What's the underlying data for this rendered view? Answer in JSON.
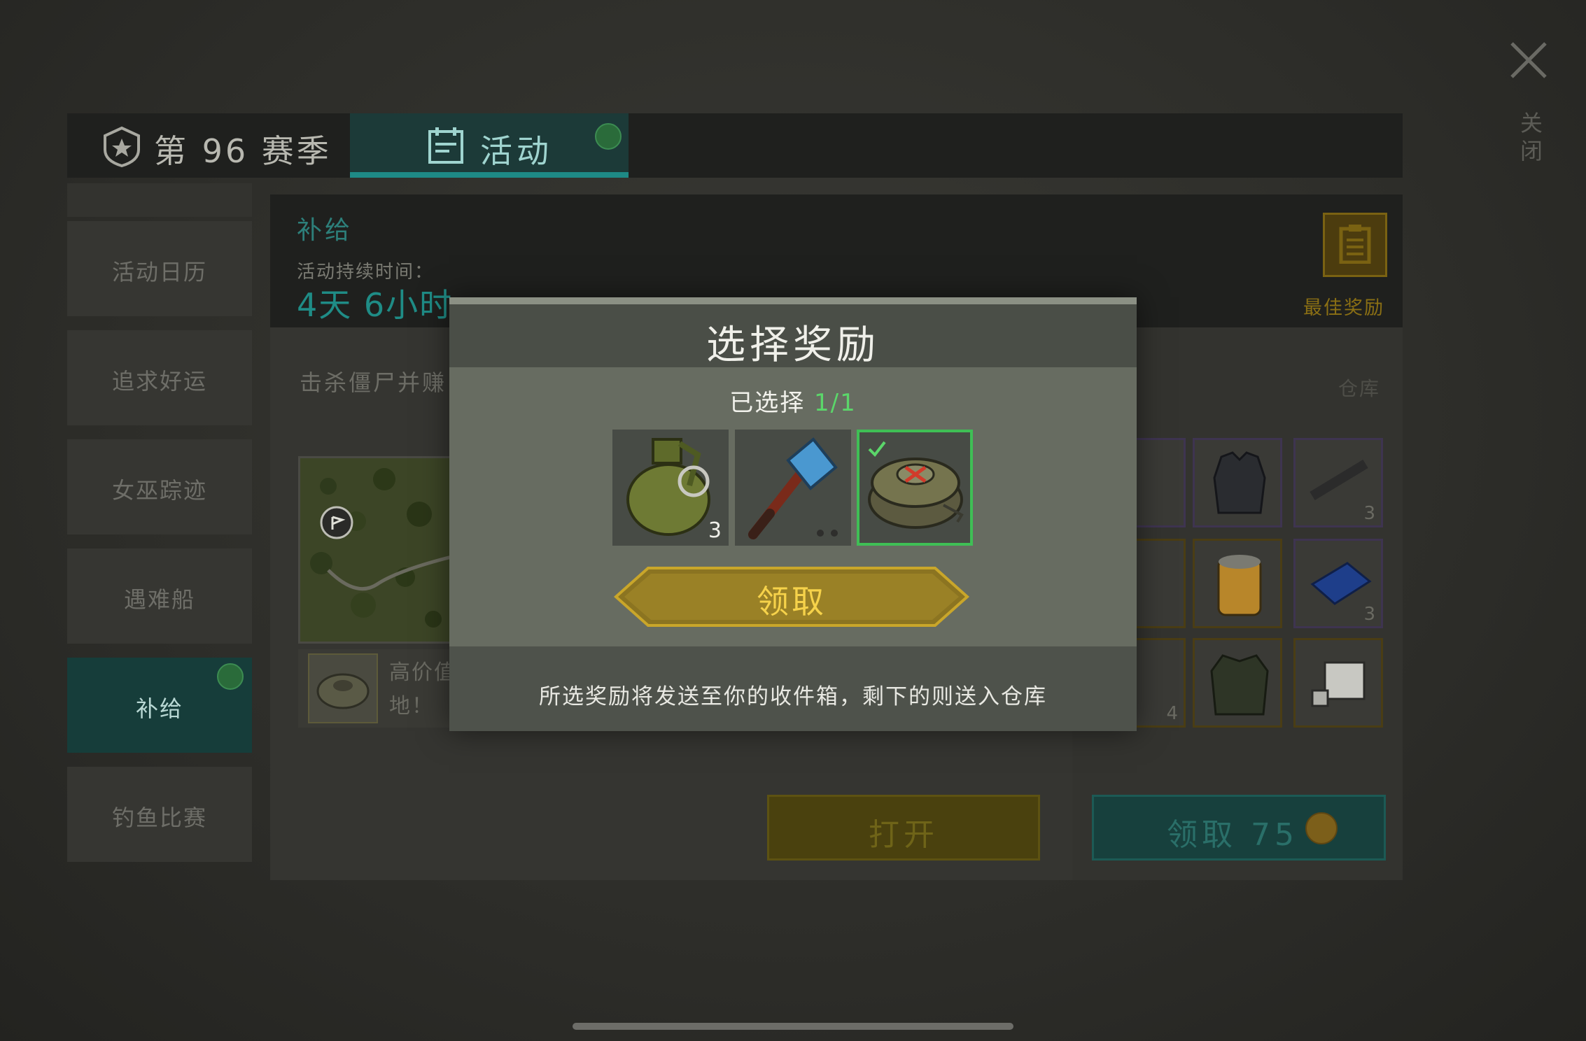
{
  "tabs": {
    "season_label": "第 96 赛季",
    "activity_label": "活动"
  },
  "sidebar": {
    "items": [
      {
        "label": "活动日历"
      },
      {
        "label": "追求好运"
      },
      {
        "label": "女巫踪迹"
      },
      {
        "label": "遇难船"
      },
      {
        "label": "补给",
        "active": true
      },
      {
        "label": "钓鱼比赛"
      }
    ]
  },
  "event": {
    "title": "补给",
    "duration_label": "活动持续时间：",
    "duration_value": "4天 6小时",
    "best_reward_label": "最佳奖励",
    "description": "击杀僵尸并赚",
    "reward_text_line1": "高价值",
    "reward_text_line2": "地！",
    "open_button": "打开",
    "warehouse_label": "仓库",
    "claim_label": "领取",
    "claim_amount": "75",
    "grid_counts": [
      "3",
      "3",
      "4"
    ]
  },
  "close": {
    "label": "关闭"
  },
  "modal": {
    "title": "选择奖励",
    "selected_prefix": "已选择",
    "selected_count": "1/1",
    "items": [
      {
        "name": "grenade",
        "count": "3",
        "selected": false
      },
      {
        "name": "hammer",
        "count": "",
        "selected": false
      },
      {
        "name": "landmine",
        "count": "",
        "selected": true
      }
    ],
    "claim_button": "领取",
    "footer": "所选奖励将发送至你的收件箱，剩下的则送入仓库"
  },
  "colors": {
    "accent_teal": "#1e8a86",
    "selected_green": "#3fbf55",
    "button_gold": "#c9a62a"
  }
}
